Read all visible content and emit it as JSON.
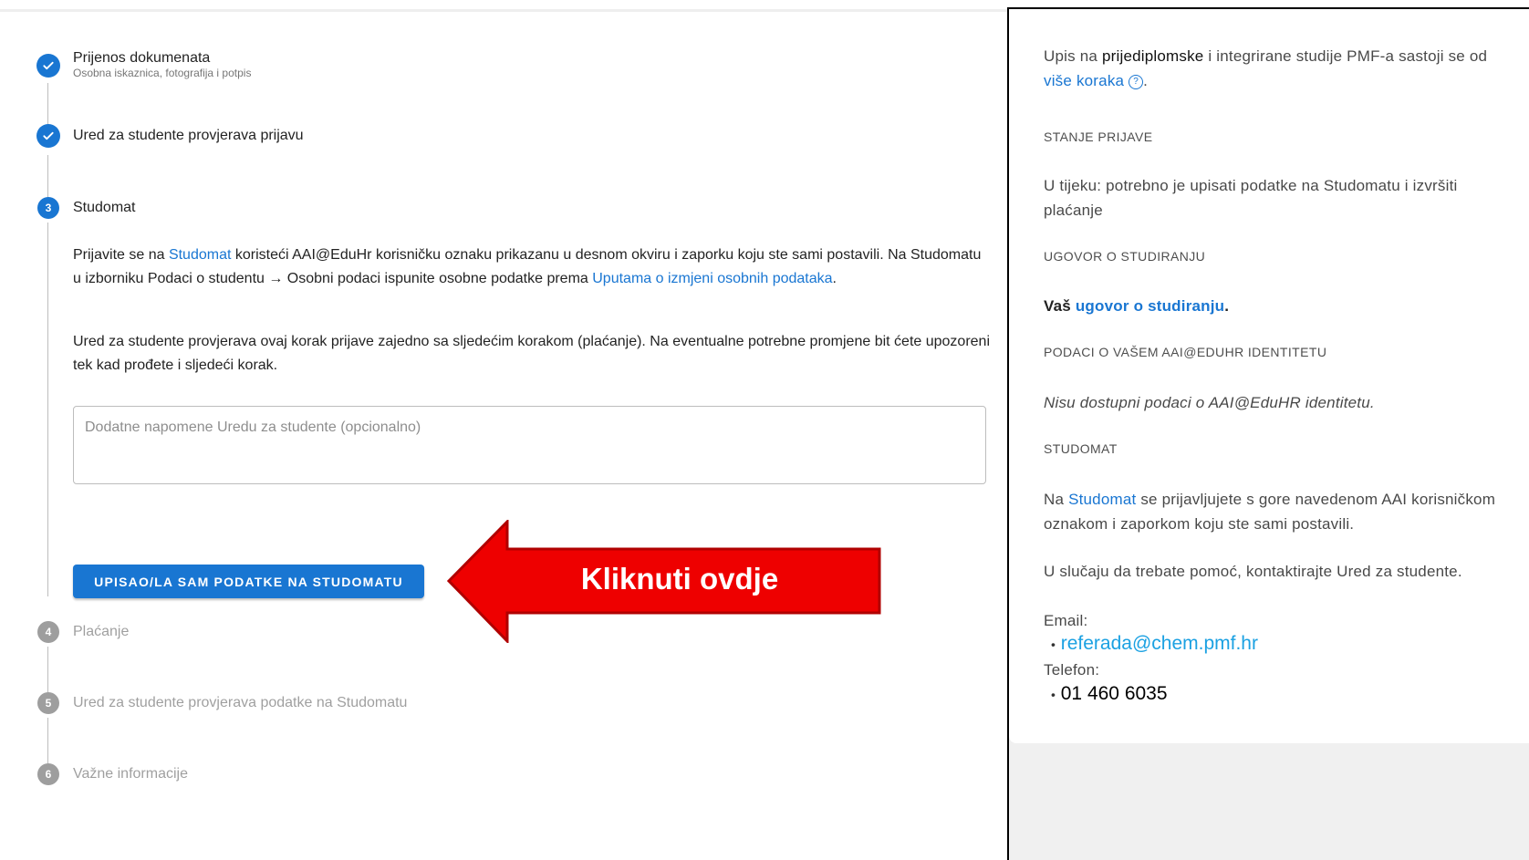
{
  "steps": [
    {
      "number": "1",
      "label": "Prijenos dokumenata",
      "sub": "Osobna iskaznica, fotografija i potpis",
      "state": "done"
    },
    {
      "number": "2",
      "label": "Ured za studente provjerava prijavu",
      "state": "done"
    },
    {
      "number": "3",
      "label": "Studomat",
      "state": "active"
    },
    {
      "number": "4",
      "label": "Plaćanje",
      "state": "todo"
    },
    {
      "number": "5",
      "label": "Ured za studente provjerava podatke na Studomatu",
      "state": "todo"
    },
    {
      "number": "6",
      "label": "Važne informacije",
      "state": "todo"
    }
  ],
  "step3": {
    "p1_a": "Prijavite se na ",
    "p1_link": "Studomat",
    "p1_b": " koristeći AAI@EduHr korisničku oznaku prikazanu u desnom okviru i zaporku koju ste sami postavili. Na Studomatu u izborniku Podaci o studentu → Osobni podaci ispunite osobne podatke prema ",
    "p1_link2": "Uputama o izmjeni osobnih podataka",
    "p1_c": ".",
    "p2": "Ured za studente provjerava ovaj korak prijave zajedno sa sljedećim korakom (plaćanje). Na eventualne potrebne promjene bit ćete upozoreni tek kad prođete i sljedeći korak.",
    "notes_placeholder": "Dodatne napomene Uredu za studente (opcionalno)",
    "button_label": "UPISAO/LA SAM PODATKE NA STUDOMATU"
  },
  "annotation": {
    "text": "Kliknuti ovdje",
    "color": "#ee0000"
  },
  "right": {
    "intro_a": "Upis na ",
    "intro_b": "prijediplomske",
    "intro_c": " i integrirane studije PMF-a sastoji se od ",
    "intro_link": "više koraka",
    "intro_icon": "?",
    "intro_d": ".",
    "h1": "STANJE PRIJAVE",
    "status": "U tijeku: potrebno je upisati podatke na Studomatu i izvršiti plaćanje",
    "h2": "UGOVOR O STUDIRANJU",
    "contract_a": "Vaš ",
    "contract_link": "ugovor o studiranju",
    "contract_b": ".",
    "h3": "PODACI O VAŠEM AAI@EDUHR IDENTITETU",
    "identity": "Nisu dostupni podaci o AAI@EduHR identitetu.",
    "h4": "STUDOMAT",
    "studomat_a": "Na ",
    "studomat_link": "Studomat",
    "studomat_b": " se prijavljujete s gore navedenom AAI korisničkom oznakom i zaporkom koju ste sami postavili.",
    "help": "U slučaju da trebate pomoć, kontaktirajte Ured za studente.",
    "email_label": "Email:",
    "email": "referada@chem.pmf.hr",
    "phone_label": "Telefon:",
    "phone": "01 460 6035"
  },
  "colors": {
    "primary": "#1976d2",
    "inactive": "#9e9e9e",
    "link_cyan": "#1ba1e2"
  }
}
